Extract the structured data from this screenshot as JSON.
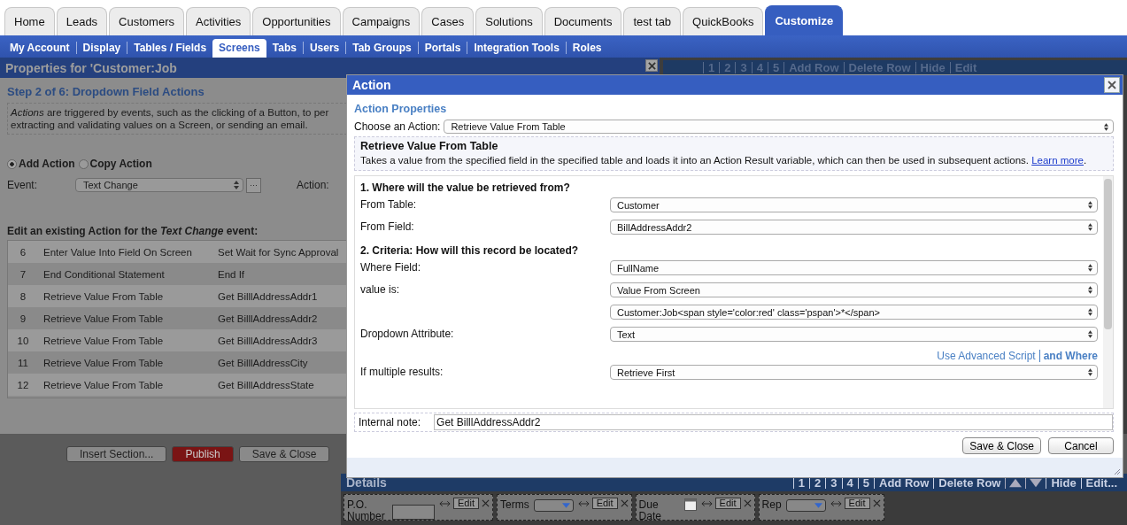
{
  "top_tabs": [
    {
      "label": "Home",
      "selected": false
    },
    {
      "label": "Leads",
      "selected": false
    },
    {
      "label": "Customers",
      "selected": false
    },
    {
      "label": "Activities",
      "selected": false
    },
    {
      "label": "Opportunities",
      "selected": false
    },
    {
      "label": "Campaigns",
      "selected": false
    },
    {
      "label": "Cases",
      "selected": false
    },
    {
      "label": "Solutions",
      "selected": false
    },
    {
      "label": "Documents",
      "selected": false
    },
    {
      "label": "test tab",
      "selected": false
    },
    {
      "label": "QuickBooks",
      "selected": false
    },
    {
      "label": "Customize",
      "selected": true
    }
  ],
  "sub_nav": [
    {
      "label": "My Account",
      "selected": false
    },
    {
      "label": "Display",
      "selected": false
    },
    {
      "label": "Tables / Fields",
      "selected": false
    },
    {
      "label": "Screens",
      "selected": true
    },
    {
      "label": "Tabs",
      "selected": false
    },
    {
      "label": "Users",
      "selected": false
    },
    {
      "label": "Tab Groups",
      "selected": false
    },
    {
      "label": "Portals",
      "selected": false
    },
    {
      "label": "Integration Tools",
      "selected": false
    },
    {
      "label": "Roles",
      "selected": false
    }
  ],
  "properties_panel": {
    "title": "Properties for 'Customer:Job",
    "step_title": "Step 2 of 6: Dropdown Field Actions",
    "description": [
      "*Actions* are triggered by events, such as the clicking of a Button, to per",
      "extracting and validating values on a Screen, or sending an email."
    ],
    "mode_options": [
      {
        "label": "Add Action",
        "selected": true
      },
      {
        "label": "Copy Action",
        "selected": false
      }
    ],
    "event_label": "Event:",
    "event_value": "Text Change",
    "event_more": "···",
    "action_label": "Action:",
    "table_heading": "Edit an existing Action for the *Text Change* event:",
    "rows": [
      {
        "number": "6",
        "action": "Enter Value Into Field On Screen",
        "detail": "Set Wait for Sync Approval"
      },
      {
        "number": "7",
        "action": "End Conditional Statement",
        "detail": "End If"
      },
      {
        "number": "8",
        "action": "Retrieve Value From Table",
        "detail": "Get BilllAddressAddr1"
      },
      {
        "number": "9",
        "action": "Retrieve Value From Table",
        "detail": "Get BilllAddressAddr2"
      },
      {
        "number": "10",
        "action": "Retrieve Value From Table",
        "detail": "Get BilllAddressAddr3"
      },
      {
        "number": "11",
        "action": "Retrieve Value From Table",
        "detail": "Get BilllAddressCity"
      },
      {
        "number": "12",
        "action": "Retrieve Value From Table",
        "detail": "Get BilllAddressState"
      }
    ],
    "buttons": [
      {
        "label": "Insert Section...",
        "kind": "plain"
      },
      {
        "label": "Publish",
        "kind": "danger"
      },
      {
        "label": "Save & Close",
        "kind": "plain"
      }
    ]
  },
  "layout_toolbar": {
    "links_before": [
      "1",
      "2",
      "3",
      "4",
      "5",
      "Add Row",
      "Delete Row"
    ],
    "links_after": [
      "Hide",
      "Edit"
    ]
  },
  "details": {
    "title": "Details",
    "links_before": [
      "1",
      "2",
      "3",
      "4",
      "5",
      "Add Row",
      "Delete Row"
    ],
    "links_after": [
      "Hide",
      "Edit..."
    ],
    "fields": [
      {
        "label": "P.O. Number",
        "kind": "input",
        "edit": "Edit"
      },
      {
        "label": "Terms",
        "kind": "select",
        "edit": "Edit"
      },
      {
        "label": "Due Date",
        "kind": "date",
        "edit": "Edit"
      },
      {
        "label": "Rep",
        "kind": "select",
        "edit": "Edit"
      }
    ]
  },
  "modal": {
    "title": "Action",
    "section_title": "Action Properties",
    "choose_label": "Choose an Action:",
    "choose_value": "Retrieve Value From Table",
    "info_title": "Retrieve Value From Table",
    "info_text": "Takes a value from the specified field in the specified table and loads it into an Action Result variable, which can then be used in subsequent actions.",
    "info_link": "Learn more",
    "info_end": ".",
    "rows": [
      {
        "kind": "heading",
        "text": "1. Where will the value be retrieved from?"
      },
      {
        "kind": "select",
        "label": "From Table:",
        "value": "Customer"
      },
      {
        "kind": "select",
        "label": "From Field:",
        "value": "BillAddressAddr2"
      },
      {
        "kind": "heading",
        "text": "2. Criteria: How will this record be located?"
      },
      {
        "kind": "select",
        "label": "Where Field:",
        "value": "FullName"
      },
      {
        "kind": "select",
        "label": "value is:",
        "value": "Value From Screen"
      },
      {
        "kind": "select",
        "value": "Customer:Job<span style='color:red' class='pspan'>*</span>"
      },
      {
        "kind": "select",
        "label": "Dropdown Attribute:",
        "value": "Text"
      },
      {
        "kind": "links",
        "links": [
          {
            "text": "Use Advanced Script",
            "bold": false
          },
          {
            "text": "and Where",
            "bold": true
          }
        ]
      },
      {
        "kind": "select",
        "label": "If multiple results:",
        "value": "Retrieve First"
      }
    ],
    "note_label": "Internal note:",
    "note_value": "Get BilllAddressAddr2",
    "buttons": [
      "Save & Close",
      "Cancel"
    ]
  }
}
